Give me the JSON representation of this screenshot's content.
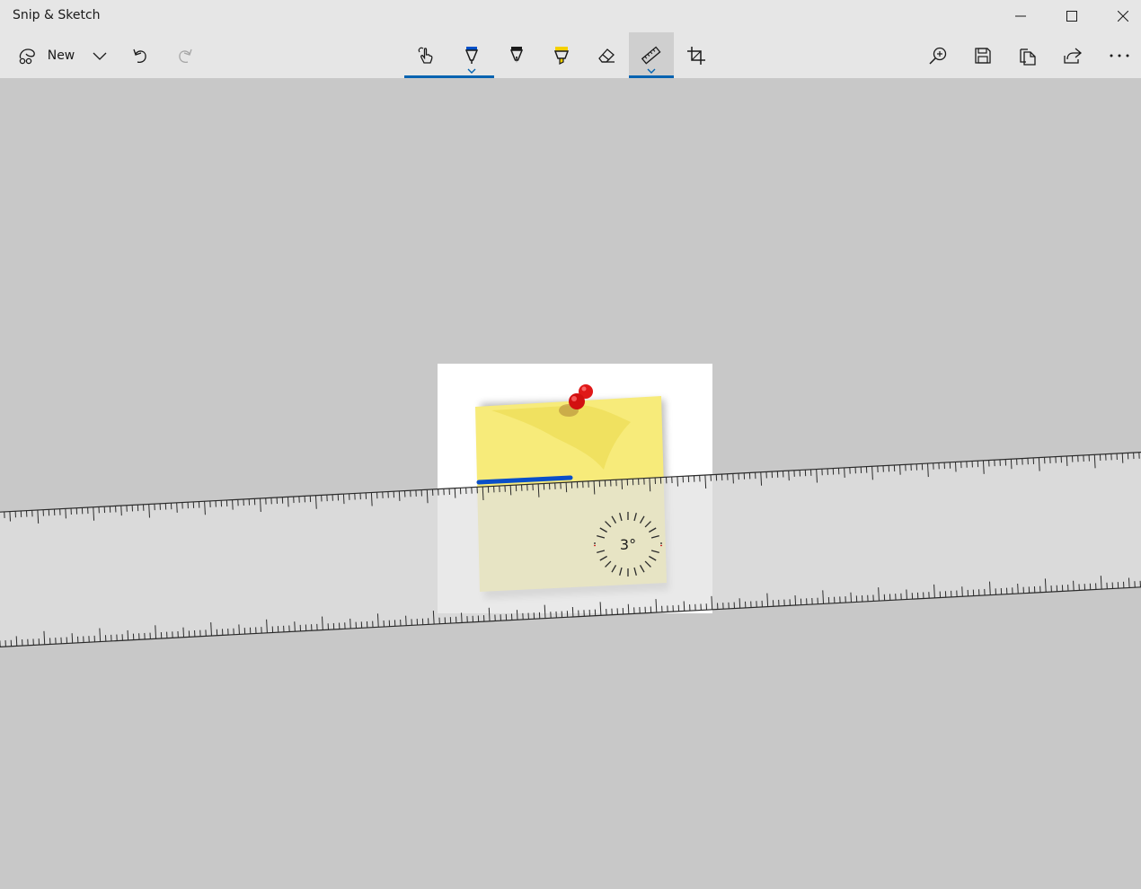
{
  "app": {
    "title": "Snip & Sketch"
  },
  "window_controls": {
    "minimize_icon": "minimize-icon",
    "maximize_icon": "maximize-icon",
    "close_icon": "close-icon"
  },
  "toolbar": {
    "new_label": "New",
    "left_tools": [
      "snip-icon",
      "chevron-down-icon",
      "undo-icon",
      "redo-icon"
    ],
    "center_tools": [
      "touch-writing-icon",
      "ballpoint-pen-icon",
      "pencil-icon",
      "highlighter-icon",
      "eraser-icon",
      "ruler-icon",
      "crop-icon"
    ],
    "right_tools": [
      "zoom-icon",
      "save-icon",
      "copy-icon",
      "share-icon",
      "more-icon"
    ],
    "selected_tools": [
      "ballpoint-pen",
      "ruler"
    ],
    "pen_color": "#0050c8",
    "highlighter_color": "#f4d000",
    "accent_color": "#0063b1"
  },
  "ruler": {
    "angle_label": "3°",
    "angle_degrees": 3
  },
  "image": {
    "content": "sticky note with red push pin",
    "note_color": "#f7eb7a",
    "pin_color": "#e01818",
    "stroke_color": "#0a4fc8"
  }
}
